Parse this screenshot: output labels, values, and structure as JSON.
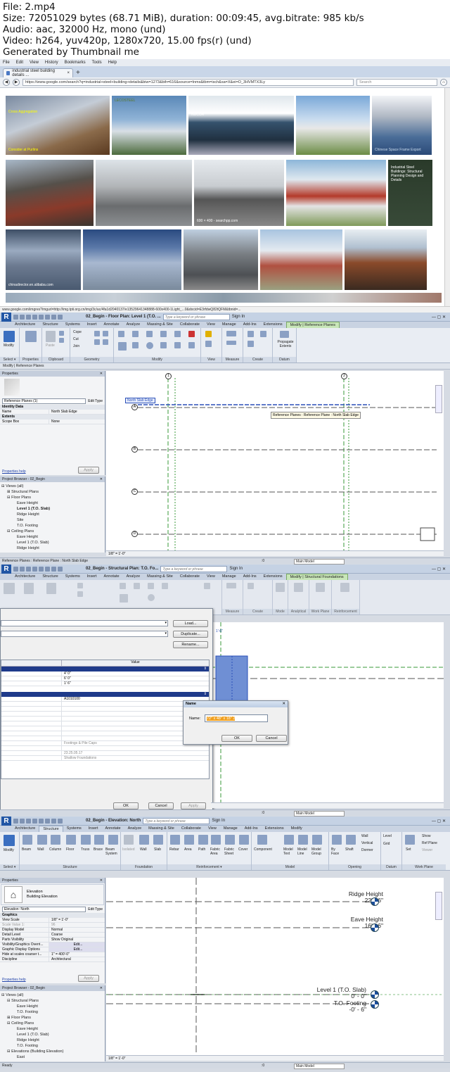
{
  "meta": {
    "line1": "File: 2.mp4",
    "line2": "Size: 72051029 bytes (68.71 MiB), duration: 00:09:45, avg.bitrate: 985 kb/s",
    "line3": "Audio: aac, 32000 Hz, mono (und)",
    "line4": "Video: h264, yuv420p, 1280x720, 15.00 fps(r) (und)",
    "line5": "Generated by Thumbnail me"
  },
  "browser": {
    "menu": [
      "File",
      "Edit",
      "View",
      "History",
      "Bookmarks",
      "Tools",
      "Help"
    ],
    "tab_title": "industrial steel building details ...",
    "url": "https://www.google.com/search?q=industrial+steel+building+details&biw=1273&bih=616&source=lnms&tbm=isch&sa=X&ei=O_3HVMTX3Ly",
    "search_placeholder": "Search",
    "thumb_labels": {
      "t1a": "Cross Aggregation",
      "t1b": "Consider at Purlins",
      "t3": "NUCOR",
      "t5": "Industrial Steel Buildings: Structural Planning Design and Details",
      "t6": "600 × 400 - searchpp.com",
      "t7": "chinadirector.en.alibaba.com",
      "t8": "LECOSTEEL",
      "t9": "Chinese Space Frame Export"
    },
    "status_url": "www.google.com/imgres?imgurl=http://img.tpti.org.cn/img/3c/ac/4fa1d2040137/e13529641348888-600x400-1Light_...0&docid=E3rfdwQ82tQFM&tbnid=..."
  },
  "rv1": {
    "title": "02_Begin - Floor Plan: Level 1 (T.O. ...",
    "keyword_placeholder": "Type a keyword or phrase",
    "signin": "Sign In",
    "tabs": [
      "Architecture",
      "Structure",
      "Systems",
      "Insert",
      "Annotate",
      "Analyze",
      "Massing & Site",
      "Collaborate",
      "View",
      "Manage",
      "Add-Ins",
      "Extensions",
      "Modify | Reference Planes"
    ],
    "panels": [
      "Select ▾",
      "Properties",
      "Clipboard",
      "Geometry",
      "Modify",
      "View",
      "Measure",
      "Create",
      "Datum"
    ],
    "buttons": {
      "modify": "Modify",
      "paste": "Paste",
      "cope": "Cope",
      "cut": "Cut",
      "join": "Join",
      "propagate": "Propagate Extents"
    },
    "option_bar": "Modify | Reference Planes",
    "properties_title": "Properties",
    "type_selector": "Reference Planes (1)",
    "edit_type": "Edit Type",
    "groups": {
      "identity": "Identity Data",
      "extents": "Extents"
    },
    "rows": [
      {
        "k": "Name",
        "v": "North Slab Edge"
      },
      {
        "k": "Scope Box",
        "v": "None"
      }
    ],
    "help": "Properties help",
    "apply": "Apply",
    "browser_title": "Project Browser - 02_Begin",
    "tree": [
      "⊟ Views (all)",
      "⊞ Structural Plans",
      "⊟ Floor Plans",
      "Eave Height",
      "Level 1 (T.O. Slab)",
      "Ridge Height",
      "Site",
      "T.O. Footing",
      "⊟ Ceiling Plans",
      "Eave Height",
      "Level 1 (T.O. Slab)",
      "Ridge Height"
    ],
    "grid_cols": [
      "1",
      "2"
    ],
    "grid_rows": [
      "A",
      "B",
      "C",
      "D"
    ],
    "ref_label": "North Slab Edge",
    "tooltip": "Reference Planes : Reference Plane : North Slab Edge",
    "scale": "1/8\" = 1'-0\"",
    "status": "Reference Planes : Reference Plane : North Slab Edge",
    "model": "Main Model",
    "zero": ":0"
  },
  "rv2": {
    "title": "02_Begin - Structural Plan: T.O. Fo...",
    "tabs": [
      "Architecture",
      "Structure",
      "Systems",
      "Insert",
      "Annotate",
      "Analyze",
      "Massing & Site",
      "Collaborate",
      "View",
      "Manage",
      "Add-Ins",
      "Extensions",
      "Modify | Structural Foundations"
    ],
    "panels": [
      "Measure",
      "Create",
      "Mode",
      "Analytical",
      "Work Plane",
      "Reinforcement"
    ],
    "type_dialog": {
      "load": "Load...",
      "duplicate": "Duplicate...",
      "rename": "Rename...",
      "value_header": "Value",
      "values": [
        "4' 0\"",
        "6' 0\"",
        "1' 6\"",
        "A1010100",
        "Footings & Pile Caps",
        "23.25.05.17",
        "Shallow Foundations"
      ],
      "ok": "OK",
      "cancel": "Cancel",
      "apply": "Apply"
    },
    "name_dialog": {
      "title": "Name",
      "label": "Name:",
      "value": "72\" x 48\" x 18\" 2",
      "ok": "OK",
      "cancel": "Cancel"
    },
    "dim": "1'-6\"",
    "model": "Main Model",
    "zero": ":0"
  },
  "rv3": {
    "title": "02_Begin - Elevation: North",
    "tabs": [
      "Architecture",
      "Structure",
      "Systems",
      "Insert",
      "Annotate",
      "Analyze",
      "Massing & Site",
      "Collaborate",
      "View",
      "Manage",
      "Add-Ins",
      "Extensions",
      "Modify"
    ],
    "panels": [
      "Select ▾",
      "Structure",
      "Foundation",
      "Reinforcement ▾",
      "Model",
      "Opening",
      "Datum",
      "Work Plane"
    ],
    "buttons": [
      "Modify",
      "Beam",
      "Wall",
      "Column",
      "Floor",
      "Truss",
      "Brace",
      "Beam System",
      "Isolated",
      "Wall",
      "Slab",
      "Rebar",
      "Area",
      "Path",
      "Fabric Area",
      "Fabric Sheet",
      "Cover",
      "Component",
      "Model Text",
      "Model Line",
      "Model Group",
      "By Face",
      "Shaft",
      "Wall",
      "Vertical",
      "Dormer",
      "Level",
      "Grid",
      "Set",
      "Show",
      "Ref Plane",
      "Viewer"
    ],
    "properties_title": "Properties",
    "type_name": "Elevation",
    "type_sub": "Building Elevation",
    "instance": "Elevation: North",
    "edit_type": "Edit Type",
    "group": "Graphics",
    "rows": [
      {
        "k": "View Scale",
        "v": "1/8\" = 1'-0\""
      },
      {
        "k": "Scale Value 1:",
        "v": "96"
      },
      {
        "k": "Display Model",
        "v": "Normal"
      },
      {
        "k": "Detail Level",
        "v": "Coarse"
      },
      {
        "k": "Parts Visibility",
        "v": "Show Original"
      },
      {
        "k": "Visibility/Graphics Overri...",
        "v": "Edit..."
      },
      {
        "k": "Graphic Display Options",
        "v": "Edit..."
      },
      {
        "k": "Hide at scales coarser t...",
        "v": "1\" = 400'-0\""
      },
      {
        "k": "Discipline",
        "v": "Architectural"
      }
    ],
    "help": "Properties help",
    "apply": "Apply",
    "browser_title": "Project Browser - 02_Begin",
    "tree": [
      "⊟ Views (all)",
      "⊟ Structural Plans",
      "Eave Height",
      "T.O. Footing",
      "⊞ Floor Plans",
      "⊟ Ceiling Plans",
      "Eave Height",
      "Level 1 (T.O. Slab)",
      "Ridge Height",
      "T.O. Footing",
      "⊟ Elevations (Building Elevation)",
      "East"
    ],
    "levels": [
      {
        "name": "Ridge Height",
        "elev": "22' - 6\""
      },
      {
        "name": "Eave Height",
        "elev": "16' - 6\""
      },
      {
        "name": "Level 1 (T.O. Slab)",
        "elev": "0' - 0\""
      },
      {
        "name": "T.O. Footing",
        "elev": "-0' - 6\""
      }
    ],
    "scale": "1/8\" = 1'-0\"",
    "status": "Ready",
    "model": "Main Model",
    "zero": ":0"
  },
  "colors": {
    "revit_blue": "#2156a5",
    "grid_green": "#3a9a3a",
    "ref_blue": "#2a4fb8",
    "foundation_blue": "#6f8fd4",
    "highlight_orange": "#f0a020"
  }
}
